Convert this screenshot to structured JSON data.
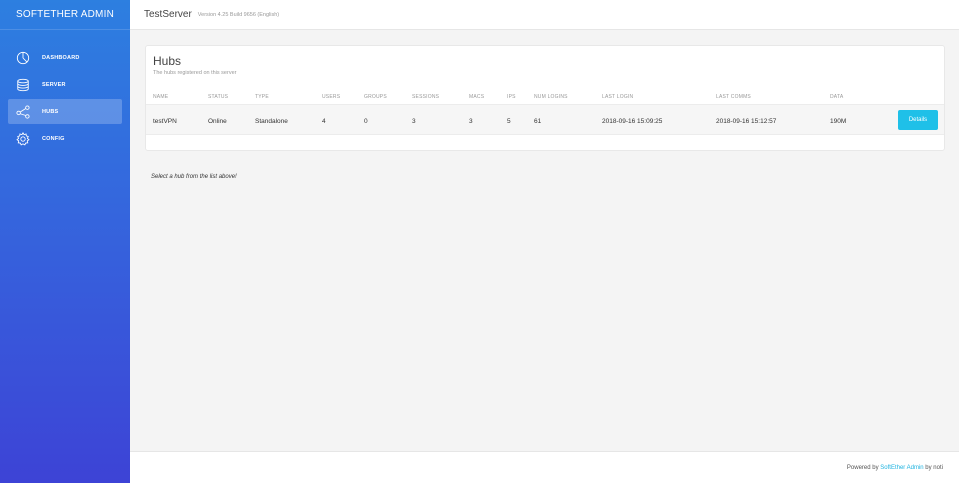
{
  "sidebar": {
    "brand": "SOFTETHER ADMIN",
    "items": [
      {
        "label": "DASHBOARD",
        "icon": "gauge-icon",
        "active": false
      },
      {
        "label": "SERVER",
        "icon": "database-icon",
        "active": false
      },
      {
        "label": "HUBS",
        "icon": "share-nodes-icon",
        "active": true
      },
      {
        "label": "CONFIG",
        "icon": "gear-icon",
        "active": false
      }
    ]
  },
  "topbar": {
    "server_name": "TestServer",
    "version": "Version 4.25 Build 9656 (English)"
  },
  "hubs": {
    "title": "Hubs",
    "subtitle": "The hubs registered on this server",
    "columns": [
      "NAME",
      "STATUS",
      "TYPE",
      "USERS",
      "GROUPS",
      "SESSIONS",
      "MACS",
      "IPS",
      "NUM LOGINS",
      "LAST LOGIN",
      "LAST COMMS",
      "DATA"
    ],
    "rows": [
      {
        "cells": [
          "testVPN",
          "Online",
          "Standalone",
          "4",
          "0",
          "3",
          "3",
          "5",
          "61",
          "2018-09-16 15:09:25",
          "2018-09-16 15:12:57",
          "190M"
        ],
        "action": "Details"
      }
    ]
  },
  "hint": "Select a hub from the list above!",
  "footer": {
    "prefix": "Powered by ",
    "link": "SoftEther Admin",
    "suffix": " by noti"
  },
  "colors": {
    "sidebar_top": "#2d7fe0",
    "sidebar_bottom": "#3d43d6",
    "accent": "#1fc0e8"
  }
}
